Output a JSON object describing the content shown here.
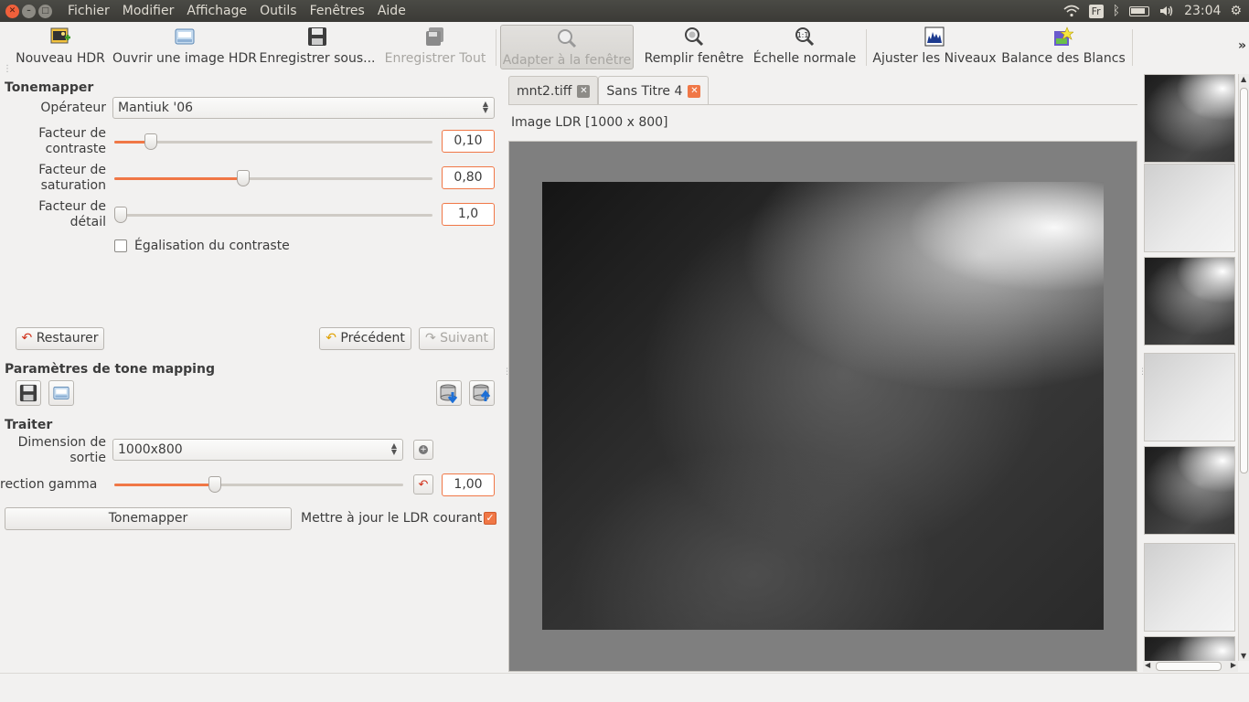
{
  "menubar": {
    "items": [
      "Fichier",
      "Modifier",
      "Affichage",
      "Outils",
      "Fenêtres",
      "Aide"
    ],
    "tray": {
      "keyboard": "Fr",
      "clock": "23:04"
    }
  },
  "toolbar": {
    "new_hdr": "Nouveau HDR",
    "open_hdr": "Ouvrir une image HDR",
    "save_as": "Enregistrer sous...",
    "save_all": "Enregistrer Tout",
    "fit_window": "Adapter à la fenêtre",
    "fill_window": "Remplir fenêtre",
    "normal_scale": "Échelle normale",
    "adjust_levels": "Ajuster les Niveaux",
    "white_balance": "Balance des Blancs",
    "more": "»"
  },
  "left": {
    "tonemapper_title": "Tonemapper",
    "operator_label": "Opérateur",
    "operator_value": "Mantiuk '06",
    "contrast_label_1": "Facteur de",
    "contrast_label_2": "contraste",
    "contrast_value": "0,10",
    "contrast_level": 0.1,
    "saturation_label_1": "Facteur de",
    "saturation_label_2": "saturation",
    "saturation_value": "0,80",
    "saturation_level": 0.4,
    "detail_label_1": "Facteur de",
    "detail_label_2": "détail",
    "detail_value": "1,0",
    "detail_level": 0.0,
    "equalize_label": "Égalisation du contraste",
    "equalize_checked": false,
    "restore_label": "Restaurer",
    "previous_label": "Précédent",
    "next_label": "Suivant",
    "params_title": "Paramètres de tone mapping",
    "process_title": "Traiter",
    "output_label_1": "Dimension de",
    "output_label_2": "sortie",
    "output_value": "1000x800",
    "gamma_label": "rection gamma",
    "gamma_value": "1,00",
    "gamma_level": 0.34,
    "tonemap_button": "Tonemapper",
    "update_ldr_label": "Mettre à jour le LDR courant",
    "update_ldr_checked": true
  },
  "center": {
    "tabs": [
      {
        "label": "mnt2.tiff",
        "active": false
      },
      {
        "label": "Sans Titre 4",
        "active": true
      }
    ],
    "image_label": "Image LDR [1000 x 800]"
  },
  "colors": {
    "accent": "#f07746",
    "panel_bg": "#f2f1f0",
    "menubar_bg": "#3c3b37",
    "viewer_bg": "#7f7f7f"
  }
}
